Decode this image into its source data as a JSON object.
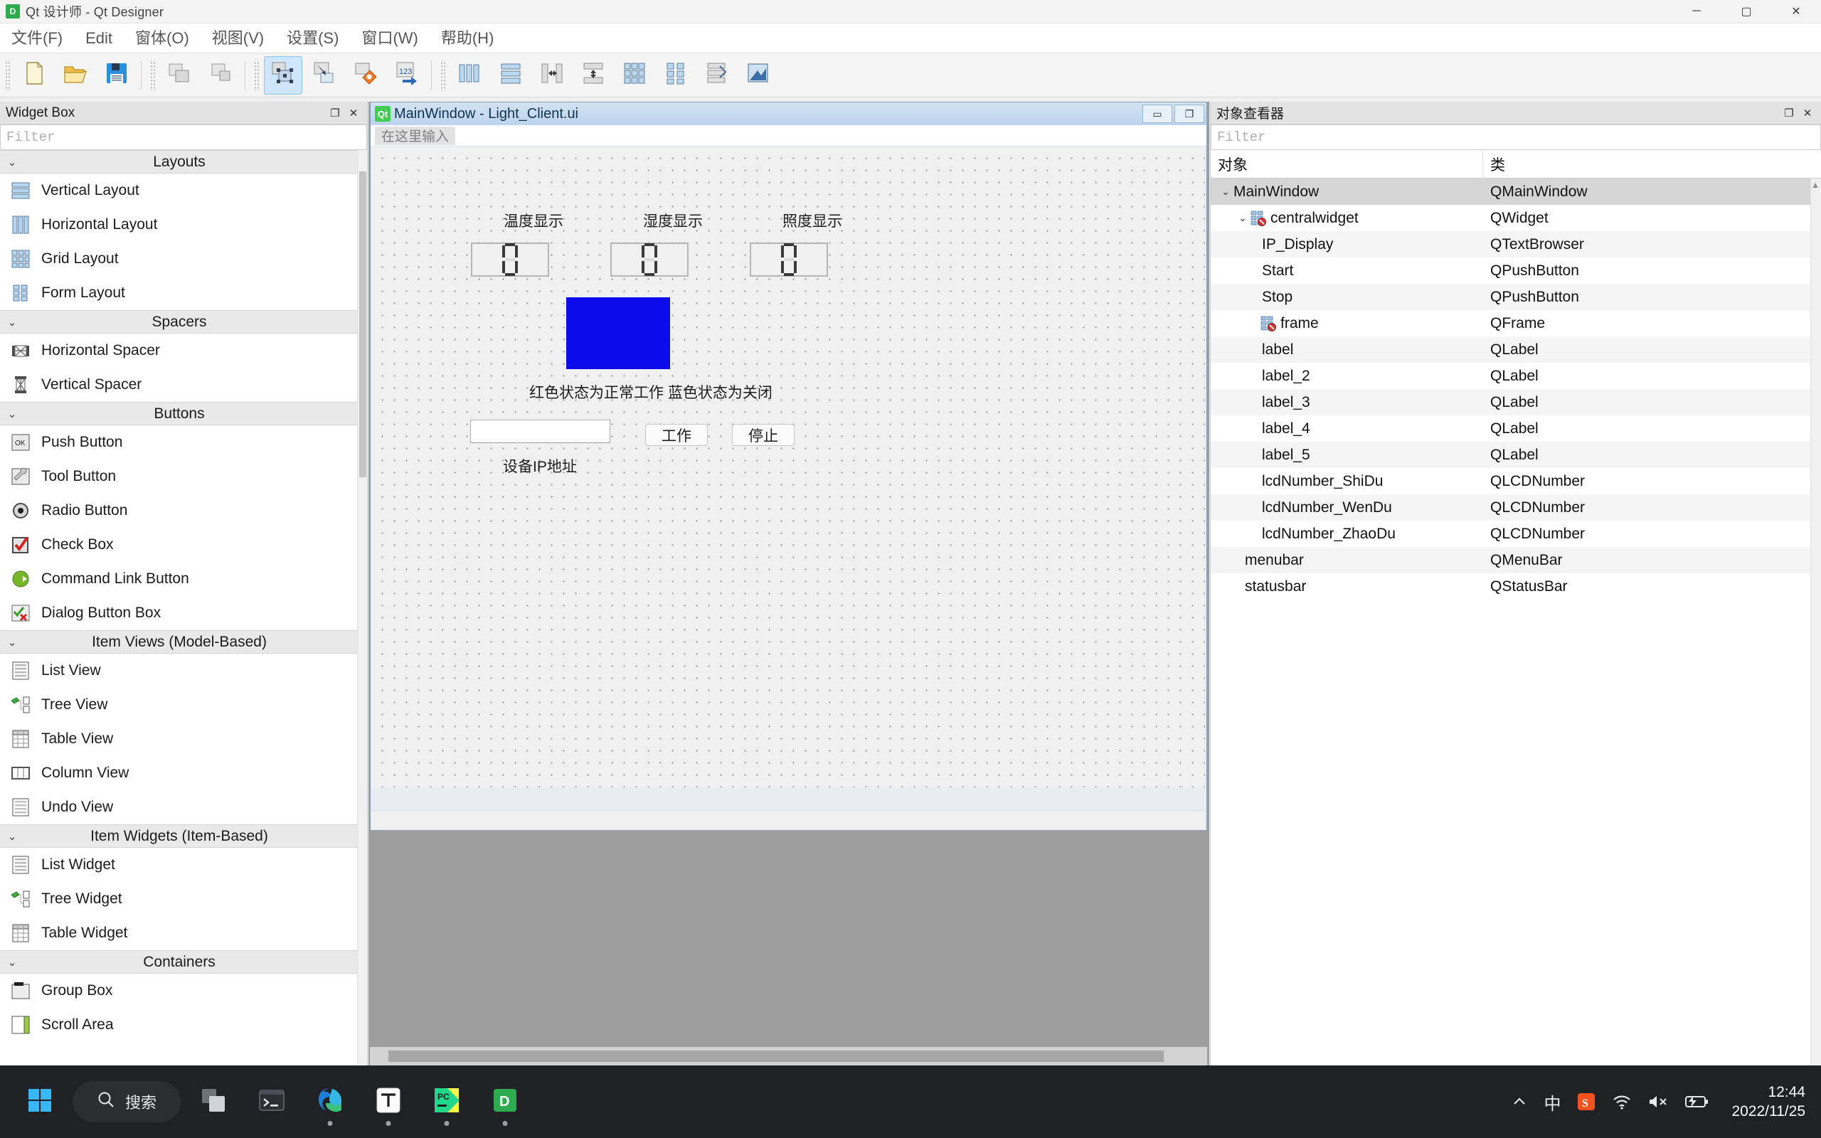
{
  "window": {
    "app_icon": "D",
    "title": "Qt 设计师 - Qt Designer",
    "controls": {
      "minimize": "─",
      "maximize": "▢",
      "close": "✕"
    }
  },
  "menubar": {
    "items": [
      {
        "label": "文件(F)",
        "name": "menu-file"
      },
      {
        "label": "Edit",
        "name": "menu-edit"
      },
      {
        "label": "窗体(O)",
        "name": "menu-form"
      },
      {
        "label": "视图(V)",
        "name": "menu-view"
      },
      {
        "label": "设置(S)",
        "name": "menu-settings"
      },
      {
        "label": "窗口(W)",
        "name": "menu-window"
      },
      {
        "label": "帮助(H)",
        "name": "menu-help"
      }
    ]
  },
  "toolbar": {
    "buttons": [
      {
        "name": "new-form-icon",
        "title": "New"
      },
      {
        "name": "open-form-icon",
        "title": "Open"
      },
      {
        "name": "save-form-icon",
        "title": "Save"
      },
      {
        "name": "undo-icon",
        "title": "Undo"
      },
      {
        "name": "redo-icon",
        "title": "Redo"
      },
      {
        "name": "edit-widgets-icon",
        "title": "Edit Widgets"
      },
      {
        "name": "edit-signals-slots-icon",
        "title": "Edit Signals/Slots"
      },
      {
        "name": "edit-buddies-icon",
        "title": "Edit Buddies"
      },
      {
        "name": "edit-tab-order-icon",
        "title": "Edit Tab Order"
      },
      {
        "name": "layout-horizontally-icon",
        "title": "Lay Out Horizontally"
      },
      {
        "name": "layout-vertically-icon",
        "title": "Lay Out Vertically"
      },
      {
        "name": "layout-splitter-horizontal-icon",
        "title": "Lay Out in Splitter Horizontally"
      },
      {
        "name": "layout-splitter-vertical-icon",
        "title": "Lay Out in Splitter Vertically"
      },
      {
        "name": "layout-grid-icon",
        "title": "Lay Out in a Grid"
      },
      {
        "name": "layout-form-icon",
        "title": "Lay Out in a Form Layout"
      },
      {
        "name": "break-layout-icon",
        "title": "Break Layout"
      },
      {
        "name": "adjust-size-icon",
        "title": "Adjust Size"
      }
    ]
  },
  "widget_box": {
    "title": "Widget Box",
    "float_btn": "❐",
    "close_btn": "✕",
    "filter_placeholder": "Filter",
    "groups": [
      {
        "label": "Layouts",
        "items": [
          {
            "label": "Vertical Layout",
            "icon": "vertical-layout-icon"
          },
          {
            "label": "Horizontal Layout",
            "icon": "horizontal-layout-icon"
          },
          {
            "label": "Grid Layout",
            "icon": "grid-layout-icon"
          },
          {
            "label": "Form Layout",
            "icon": "form-layout-icon"
          }
        ]
      },
      {
        "label": "Spacers",
        "items": [
          {
            "label": "Horizontal Spacer",
            "icon": "horizontal-spacer-icon"
          },
          {
            "label": "Vertical Spacer",
            "icon": "vertical-spacer-icon"
          }
        ]
      },
      {
        "label": "Buttons",
        "items": [
          {
            "label": "Push Button",
            "icon": "push-button-icon"
          },
          {
            "label": "Tool Button",
            "icon": "tool-button-icon"
          },
          {
            "label": "Radio Button",
            "icon": "radio-button-icon"
          },
          {
            "label": "Check Box",
            "icon": "check-box-icon"
          },
          {
            "label": "Command Link Button",
            "icon": "command-link-button-icon"
          },
          {
            "label": "Dialog Button Box",
            "icon": "dialog-button-box-icon"
          }
        ]
      },
      {
        "label": "Item Views (Model-Based)",
        "items": [
          {
            "label": "List View",
            "icon": "list-view-icon"
          },
          {
            "label": "Tree View",
            "icon": "tree-view-icon"
          },
          {
            "label": "Table View",
            "icon": "table-view-icon"
          },
          {
            "label": "Column View",
            "icon": "column-view-icon"
          },
          {
            "label": "Undo View",
            "icon": "undo-view-icon"
          }
        ]
      },
      {
        "label": "Item Widgets (Item-Based)",
        "items": [
          {
            "label": "List Widget",
            "icon": "list-widget-icon"
          },
          {
            "label": "Tree Widget",
            "icon": "tree-widget-icon"
          },
          {
            "label": "Table Widget",
            "icon": "table-widget-icon"
          }
        ]
      },
      {
        "label": "Containers",
        "items": [
          {
            "label": "Group Box",
            "icon": "group-box-icon"
          },
          {
            "label": "Scroll Area",
            "icon": "scroll-area-icon"
          }
        ]
      }
    ]
  },
  "form_window": {
    "badge": "Qt",
    "title": "MainWindow - Light_Client.ui",
    "minimize": "▭",
    "restore": "❐",
    "menu_placeholder": "在这里输入",
    "canvas": {
      "labels": [
        {
          "name": "label-wendu",
          "text": "温度显示"
        },
        {
          "name": "label-shidu",
          "text": "湿度显示"
        },
        {
          "name": "label-zhaodu",
          "text": "照度显示"
        },
        {
          "name": "label-status-legend",
          "text": "红色状态为正常工作  蓝色状态为关闭"
        },
        {
          "name": "label-ip-address",
          "text": "设备IP地址"
        }
      ],
      "lcds": [
        {
          "name": "lcdNumber_WenDu",
          "value": "0"
        },
        {
          "name": "lcdNumber_ShiDu",
          "value": "0"
        },
        {
          "name": "lcdNumber_ZhaoDu",
          "value": "0"
        }
      ],
      "status_frame_color": "#0b0bec",
      "ip_input_value": "",
      "buttons": [
        {
          "name": "start-button",
          "label": "工作"
        },
        {
          "name": "stop-button",
          "label": "停止"
        }
      ]
    }
  },
  "object_inspector": {
    "title": "对象查看器",
    "float_btn": "❐",
    "close_btn": "✕",
    "filter_placeholder": "Filter",
    "columns": [
      "对象",
      "类"
    ],
    "rows": [
      {
        "object": "MainWindow",
        "class": "QMainWindow",
        "indent": 0,
        "chevron": true,
        "icon": "",
        "selected": true
      },
      {
        "object": "centralwidget",
        "class": "QWidget",
        "indent": 1,
        "chevron": true,
        "icon": "no-layout-icon",
        "selected": false
      },
      {
        "object": "IP_Display",
        "class": "QTextBrowser",
        "indent": 2,
        "chevron": false,
        "icon": "",
        "selected": false
      },
      {
        "object": "Start",
        "class": "QPushButton",
        "indent": 2,
        "chevron": false,
        "icon": "",
        "selected": false
      },
      {
        "object": "Stop",
        "class": "QPushButton",
        "indent": 2,
        "chevron": false,
        "icon": "",
        "selected": false
      },
      {
        "object": "frame",
        "class": "QFrame",
        "indent": 2,
        "chevron": false,
        "icon": "no-layout-icon",
        "selected": false
      },
      {
        "object": "label",
        "class": "QLabel",
        "indent": 2,
        "chevron": false,
        "icon": "",
        "selected": false
      },
      {
        "object": "label_2",
        "class": "QLabel",
        "indent": 2,
        "chevron": false,
        "icon": "",
        "selected": false
      },
      {
        "object": "label_3",
        "class": "QLabel",
        "indent": 2,
        "chevron": false,
        "icon": "",
        "selected": false
      },
      {
        "object": "label_4",
        "class": "QLabel",
        "indent": 2,
        "chevron": false,
        "icon": "",
        "selected": false
      },
      {
        "object": "label_5",
        "class": "QLabel",
        "indent": 2,
        "chevron": false,
        "icon": "",
        "selected": false
      },
      {
        "object": "lcdNumber_ShiDu",
        "class": "QLCDNumber",
        "indent": 2,
        "chevron": false,
        "icon": "",
        "selected": false
      },
      {
        "object": "lcdNumber_WenDu",
        "class": "QLCDNumber",
        "indent": 2,
        "chevron": false,
        "icon": "",
        "selected": false
      },
      {
        "object": "lcdNumber_ZhaoDu",
        "class": "QLCDNumber",
        "indent": 2,
        "chevron": false,
        "icon": "",
        "selected": false
      },
      {
        "object": "menubar",
        "class": "QMenuBar",
        "indent": 1,
        "chevron": false,
        "icon": "",
        "selected": false
      },
      {
        "object": "statusbar",
        "class": "QStatusBar",
        "indent": 1,
        "chevron": false,
        "icon": "",
        "selected": false
      }
    ]
  },
  "taskbar": {
    "start_name": "windows-start-icon",
    "search_label": "搜索",
    "apps": [
      {
        "name": "task-view-icon",
        "running": false
      },
      {
        "name": "terminal-icon",
        "running": false
      },
      {
        "name": "microsoft-edge-icon",
        "running": true
      },
      {
        "name": "typora-icon",
        "running": true
      },
      {
        "name": "pycharm-icon",
        "running": true
      },
      {
        "name": "qt-designer-icon",
        "running": true
      }
    ],
    "tray": [
      {
        "name": "show-hidden-icons-icon",
        "glyph": "︿"
      },
      {
        "name": "ime-chinese-icon",
        "glyph": "中"
      },
      {
        "name": "sogou-input-icon",
        "glyph": "S"
      },
      {
        "name": "wifi-icon",
        "glyph": "wifi"
      },
      {
        "name": "volume-muted-icon",
        "glyph": "mute"
      },
      {
        "name": "battery-charging-icon",
        "glyph": "battery"
      }
    ],
    "clock": {
      "time": "12:44",
      "date": "2022/11/25"
    }
  }
}
